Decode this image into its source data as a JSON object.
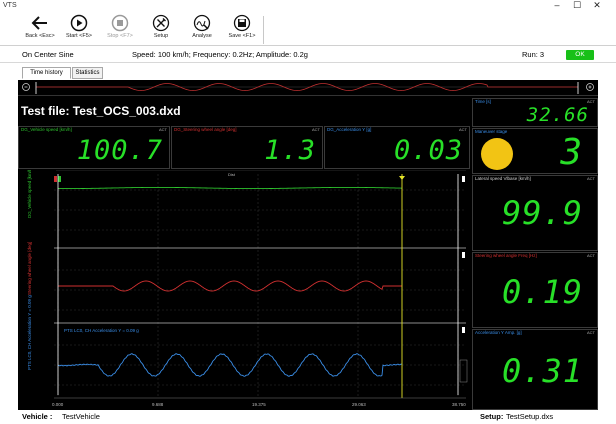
{
  "app": {
    "title": "VTS"
  },
  "toolbar": {
    "back_label": "Back <Esc>",
    "start_label": "Start <F5>",
    "stop_label": "Stop <F7>",
    "setup_label": "Setup",
    "analyse_label": "Analyse",
    "save_label": "Save <F1>"
  },
  "info": {
    "test_name": "On Center Sine",
    "params": "Speed: 100 km/h; Frequency: 0.2Hz; Amplitude: 0.2g",
    "run": "Run: 3",
    "status": "OK",
    "status_color": "#18c018"
  },
  "tabs": [
    {
      "label": "Time history"
    },
    {
      "label": "Statistics"
    }
  ],
  "display": {
    "test_file": "Test file: Test_OCS_003.dxd",
    "act": "ACT",
    "vehicle_speed": {
      "label": "DG_Vehicle speed [km/h]",
      "value": "100.7",
      "color": "#2ec42e"
    },
    "steering_angle": {
      "label": "DG_Steering wheel angle [deg]",
      "value": "1.3",
      "color": "#d03030"
    },
    "acceleration": {
      "label": "DG_Acceleration Y [g]",
      "value": "0.03",
      "color": "#3a8ee8"
    },
    "time": {
      "label": "Time [s]",
      "value": "32.66",
      "color": "#3a8ee8"
    },
    "maneuver": {
      "label": "Maneuver stage",
      "value": "3",
      "color": "#3a8ee8"
    },
    "lateral_speed": {
      "label": "Lateral speed Vlbase [km/h]",
      "value": "99.9",
      "color": "#d0d0d0"
    },
    "steering_freq": {
      "label": "Steering wheel angle Freq [Hz]",
      "value": "0.19",
      "color": "#d03030"
    },
    "accel_amp": {
      "label": "Acceleration Y Amp. [g]",
      "value": "0.31",
      "color": "#3a8ee8"
    }
  },
  "chart_data": {
    "type": "line",
    "x_ticks": [
      "0.000",
      "9.688",
      "19.375",
      "29.063",
      "38.750"
    ],
    "xlim": [
      0,
      38.75
    ],
    "channels": [
      {
        "name": "DG_Vehicle speed [km/h]",
        "color": "#2ec42e"
      },
      {
        "name": "Steering wheel angle [deg]",
        "color": "#d03030"
      },
      {
        "name": "PTS LC0, CH Acceleration Y = 0.09 g",
        "color": "#3a8ee8"
      }
    ],
    "cursor_color": "#e6e62a"
  },
  "bottom": {
    "vehicle_label": "Vehicle :",
    "vehicle_value": "TestVehicle",
    "setup_label": "Setup:",
    "setup_value": "TestSetup.dxs"
  }
}
